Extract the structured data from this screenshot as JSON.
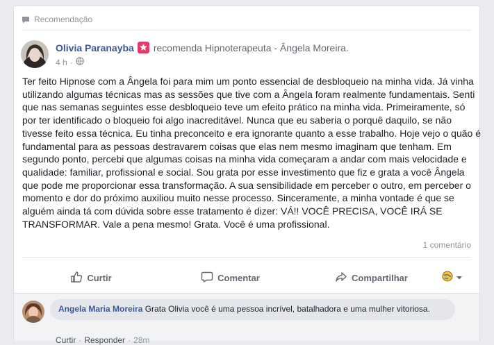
{
  "post": {
    "recommendation_label": "Recomendação",
    "author": "Olivia Paranayba",
    "recommends_text": "recomenda Hipnoterapeuta - Ângela Moreira.",
    "time": "4 h",
    "dot": "·",
    "text": "Ter feito Hipnose com a Ângela foi para mim um ponto essencial de desbloqueio na minha vida. Já vinha utilizando algumas técnicas mas as sessões que tive com a Ângela foram realmente fundamentais. Senti que nas semanas seguintes esse desbloqueio teve um efeito prático na minha vida. Primeiramente, só por ter identificado o bloqueio foi algo inacreditável. Nunca que eu saberia o porquê daquilo, se não tivesse feito essa técnica. Eu tinha preconceito e era ignorante quanto a esse trabalho. Hoje vejo o quão é fundamental para as pessoas destravarem coisas que elas nem mesmo imaginam que tenham. Em segundo ponto, percebi que algumas coisas na minha vida começaram a andar com mais velocidade e qualidade: familiar, profissional e social. Sou grata por esse investimento que fiz e grata a você Ângela que pode me proporcionar essa transformação. A sua sensibilidade em perceber o outro, em perceber o momento e dor do próximo auxiliou muito nesse processo. Sinceramente, a minha vontade é que se alguém ainda tá com dúvida sobre esse tratamento é dizer: VÁ!! VOCÊ PRECISA, VOCÊ IRÁ SE TRANSFORMAR. Vale a pena mesmo! Grata. Você é uma profissional.",
    "comment_count": "1 comentário"
  },
  "actions": {
    "like": "Curtir",
    "comment": "Comentar",
    "share": "Compartilhar"
  },
  "comment": {
    "author": "Angela Maria Moreira",
    "text": "Grata Olivia você é uma pessoa incrível, batalhadora e uma mulher vitoriosa.",
    "like": "Curtir",
    "reply": "Responder",
    "time": "28m",
    "dot": "·"
  },
  "colors": {
    "link_blue": "#385898",
    "badge_pink": "#e7386a",
    "muted": "#90949c",
    "background": "#e9ebee"
  },
  "icons": {
    "recommendation": "speech-bubble-icon",
    "badge": "star-badge-icon",
    "audience": "globe-icon",
    "like": "thumbs-up-icon",
    "comment": "comment-bubble-icon",
    "share": "share-arrow-icon",
    "audience_selector": "globe-dropdown-icon"
  }
}
